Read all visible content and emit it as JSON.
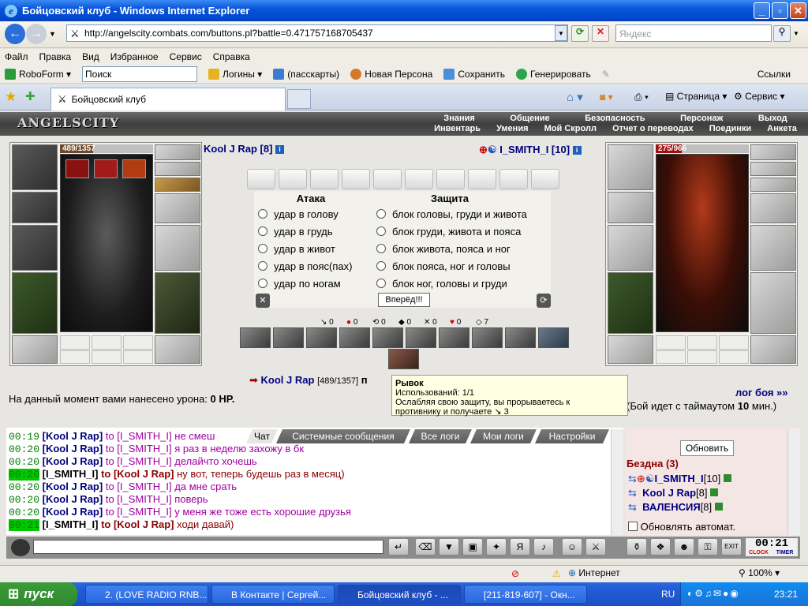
{
  "window": {
    "title": "Бойцовский клуб - Windows Internet Explorer"
  },
  "browser": {
    "url": "http://angelscity.combats.com/buttons.pl?battle=0.471757168705437",
    "search_placeholder": "Яндекс",
    "menu": [
      "Файл",
      "Правка",
      "Вид",
      "Избранное",
      "Сервис",
      "Справка"
    ],
    "toolbar": {
      "roboform": "RoboForm",
      "search": "Поиск",
      "logins": "Логины",
      "passcards": "(пасскарты)",
      "new_persona": "Новая Персона",
      "save": "Сохранить",
      "generate": "Генерировать",
      "links": "Ссылки"
    },
    "tab_title": "Бойцовский клуб",
    "cmd": {
      "page": "Страница",
      "service": "Сервис"
    }
  },
  "game": {
    "logo": "ANGELSCITY",
    "top_menu": [
      "Знания",
      "Общение",
      "Безопасность",
      "Персонаж",
      "Выход"
    ],
    "sub_menu": [
      "Инвентарь",
      "Умения",
      "Мой Скролл",
      "Отчет о переводах",
      "Поединки",
      "Анкета"
    ],
    "player": {
      "name": "Kool J Rap [8]",
      "hp": "489/1357",
      "hp_fraction": 0.36
    },
    "enemy": {
      "name": "I_SMITH_I [10]",
      "hp": "275/966",
      "hp_fraction": 0.28
    },
    "attack_title": "Атака",
    "defense_title": "Защита",
    "attacks": [
      "удар в голову",
      "удар в грудь",
      "удар в живот",
      "удар в пояс(пах)",
      "удар по ногам"
    ],
    "defenses": [
      "блок головы, груди и живота",
      "блок груди, живота и пояса",
      "блок живота, пояса и ног",
      "блок пояса, ног и головы",
      "блок ног, головы и груди"
    ],
    "forward_btn": "Вперёд!!!",
    "stats": [
      "0",
      "0",
      "0",
      "0",
      "0",
      "0",
      "7"
    ],
    "status_name": "Kool J Rap",
    "status_hp": "[489/1357]",
    "status_suffix": "п",
    "damage_label": "На данный момент вами нанесено урона:",
    "damage_value": "0 HP.",
    "battle_log": "лог боя »»",
    "timeout_pre": "(Бой идет с таймаутом",
    "timeout_val": "10",
    "timeout_post": "мин.)",
    "tooltip": {
      "title": "Рывок",
      "uses": "Использований: 1/1",
      "desc1": "Ослабляя свою защиту, вы прорываетесь к",
      "desc2": "противнику и получаете",
      "desc2_value": "3"
    }
  },
  "chat": {
    "tabs": [
      "Чат",
      "Системные сообщения",
      "Все логи",
      "Мои логи",
      "Настройки"
    ],
    "lines": [
      {
        "time": "00:19",
        "from": "[Kool J Rap]",
        "to": "to [I_SMITH_I]",
        "msg": "не смеш",
        "hl": false
      },
      {
        "time": "00:20",
        "from": "[Kool J Rap]",
        "to": "to [I_SMITH_I]",
        "msg": "я раз в неделю захожу в бк",
        "hl": false
      },
      {
        "time": "00:20",
        "from": "[Kool J Rap]",
        "to": "to [I_SMITH_I]",
        "msg": "делайчто хочешь",
        "hl": false
      },
      {
        "time": "00:20",
        "from": "[I_SMITH_I]",
        "to": "to [Kool J Rap]",
        "msg": "ну вот, теперь будешь раз в месяц)",
        "hl": true
      },
      {
        "time": "00:20",
        "from": "[Kool J Rap]",
        "to": "to [I_SMITH_I]",
        "msg": "да мне срать",
        "hl": false
      },
      {
        "time": "00:20",
        "from": "[Kool J Rap]",
        "to": "to [I_SMITH_I]",
        "msg": "поверь",
        "hl": false
      },
      {
        "time": "00:20",
        "from": "[Kool J Rap]",
        "to": "to [I_SMITH_I]",
        "msg": "у меня же тоже есть хорошие друзья",
        "hl": false
      },
      {
        "time": "00:21",
        "from": "[I_SMITH_I]",
        "to": "to [Kool J Rap]",
        "msg": "ходи давай)",
        "hl": true
      }
    ],
    "refresh_btn": "Обновить",
    "room": "Бездна (3)",
    "users": [
      {
        "name": "I_SMITH_I",
        "lvl": "[10]"
      },
      {
        "name": "Kool J Rap",
        "lvl": "[8]"
      },
      {
        "name": "ВАЛЕНСИЯ",
        "lvl": "[8]"
      }
    ],
    "auto_refresh": "Обновлять автомат.",
    "clock": "00:21",
    "clock_tab1": "CLOCK",
    "clock_tab2": "TIMER"
  },
  "statusbar": {
    "zone": "Интернет",
    "zoom": "100%"
  },
  "taskbar": {
    "start": "пуск",
    "tasks": [
      "2. (LOVE RADIO RNB...",
      "В Контакте | Сергей...",
      "Бойцовский клуб - ...",
      "[211-819-607] - Окн..."
    ],
    "lang": "RU",
    "time": "23:21"
  }
}
